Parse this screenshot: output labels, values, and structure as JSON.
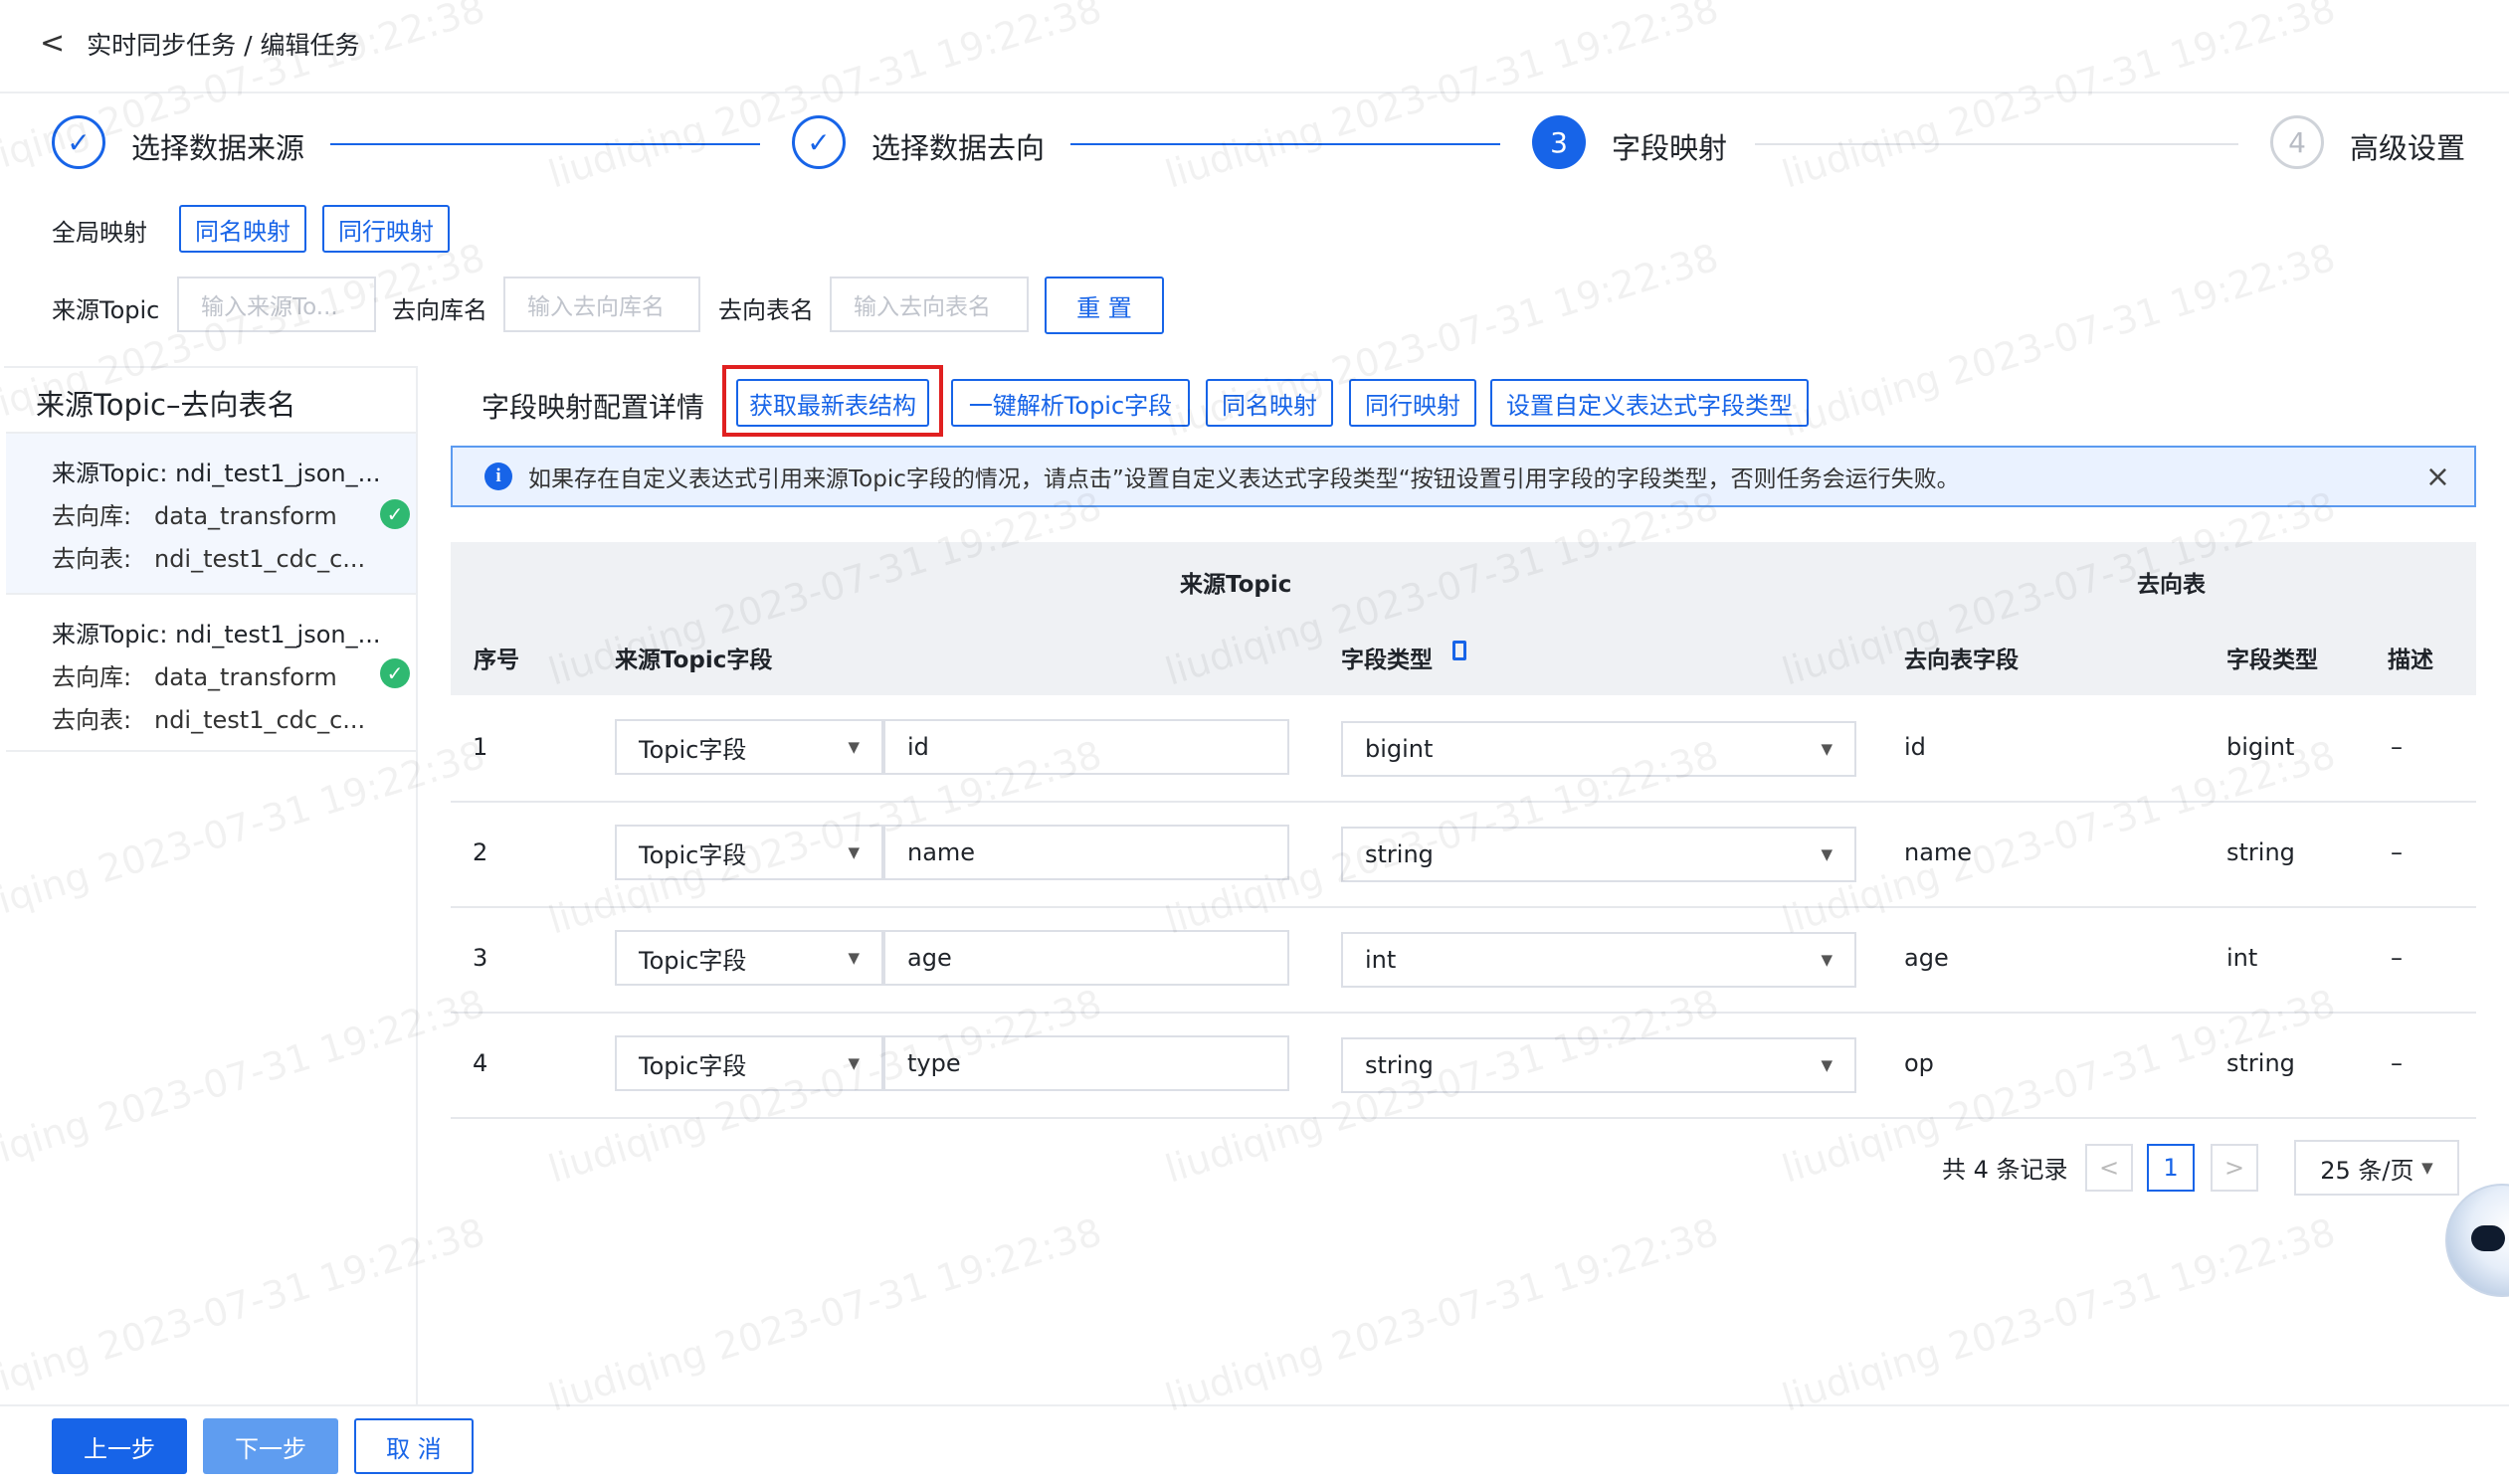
{
  "header": {
    "back_glyph": "<",
    "breadcrumb": "实时同步任务 / 编辑任务"
  },
  "steps": [
    {
      "num": "✓",
      "label": "选择数据来源",
      "state": "done"
    },
    {
      "num": "✓",
      "label": "选择数据去向",
      "state": "done"
    },
    {
      "num": "3",
      "label": "字段映射",
      "state": "active"
    },
    {
      "num": "4",
      "label": "高级设置",
      "state": "wait"
    }
  ],
  "global_mapping": {
    "label": "全局映射",
    "same_name": "同名映射",
    "same_row": "同行映射"
  },
  "filters": {
    "source_topic_label": "来源Topic",
    "source_topic_placeholder": "输入来源To...",
    "target_db_label": "去向库名",
    "target_db_placeholder": "输入去向库名",
    "target_table_label": "去向表名",
    "target_table_placeholder": "输入去向表名",
    "reset": "重 置"
  },
  "left_panel": {
    "title": "来源Topic–去向表名",
    "items": [
      {
        "topic": "来源Topic: ndi_test1_json_...",
        "db_label": "去向库:",
        "db": "data_transform",
        "table_label": "去向表:",
        "table": "ndi_test1_cdc_c..."
      },
      {
        "topic": "来源Topic: ndi_test1_json_...",
        "db_label": "去向库:",
        "db": "data_transform",
        "table_label": "去向表:",
        "table": "ndi_test1_cdc_c..."
      }
    ]
  },
  "details": {
    "title": "字段映射配置详情",
    "buttons": [
      "获取最新表结构",
      "一键解析Topic字段",
      "同名映射",
      "同行映射",
      "设置自定义表达式字段类型"
    ]
  },
  "alert": {
    "text": "如果存在自定义表达式引用来源Topic字段的情况，请点击”设置自定义表达式字段类型“按钮设置引用字段的字段类型，否则任务会运行失败。",
    "close": "×"
  },
  "table": {
    "group_source": "来源Topic",
    "group_target": "去向表",
    "columns": [
      "序号",
      "来源Topic字段",
      "字段类型",
      "去向表字段",
      "字段类型",
      "描述"
    ],
    "rows": [
      {
        "no": "1",
        "src_kind": "Topic字段",
        "src_field": "id",
        "type": "bigint",
        "tgt_field": "id",
        "tgt_type": "bigint",
        "desc": "–"
      },
      {
        "no": "2",
        "src_kind": "Topic字段",
        "src_field": "name",
        "type": "string",
        "tgt_field": "name",
        "tgt_type": "string",
        "desc": "–"
      },
      {
        "no": "3",
        "src_kind": "Topic字段",
        "src_field": "age",
        "type": "int",
        "tgt_field": "age",
        "tgt_type": "int",
        "desc": "–"
      },
      {
        "no": "4",
        "src_kind": "Topic字段",
        "src_field": "type",
        "type": "string",
        "tgt_field": "op",
        "tgt_type": "string",
        "desc": "–"
      }
    ]
  },
  "pagination": {
    "total": "共 4 条记录",
    "prev": "<",
    "page": "1",
    "next": ">",
    "page_size": "25 条/页"
  },
  "footer": {
    "prev": "上一步",
    "next": "下一步",
    "cancel": "取 消"
  },
  "watermark": "liudiqing 2023-07-31 19:22:38",
  "colors": {
    "primary": "#1764e8",
    "highlight": "#e02020",
    "success": "#2fb971"
  }
}
